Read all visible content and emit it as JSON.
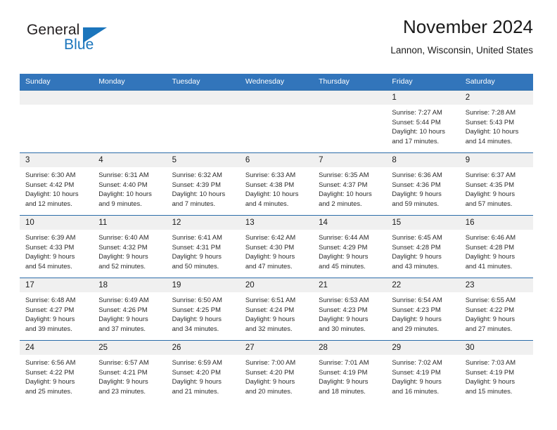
{
  "brand": {
    "name_part1": "General",
    "name_part2": "Blue",
    "accent_color": "#1b75bc",
    "logo_icon": "triangle-icon"
  },
  "header": {
    "title": "November 2024",
    "subtitle": "Lannon, Wisconsin, United States"
  },
  "calendar": {
    "header_bg": "#3275bb",
    "daynum_bg": "#f0f0f0",
    "border_color": "#2b6ca8",
    "weekdays": [
      "Sunday",
      "Monday",
      "Tuesday",
      "Wednesday",
      "Thursday",
      "Friday",
      "Saturday"
    ],
    "weeks": [
      [
        {
          "day": "",
          "sunrise": "",
          "sunset": "",
          "daylight": ""
        },
        {
          "day": "",
          "sunrise": "",
          "sunset": "",
          "daylight": ""
        },
        {
          "day": "",
          "sunrise": "",
          "sunset": "",
          "daylight": ""
        },
        {
          "day": "",
          "sunrise": "",
          "sunset": "",
          "daylight": ""
        },
        {
          "day": "",
          "sunrise": "",
          "sunset": "",
          "daylight": ""
        },
        {
          "day": "1",
          "sunrise": "Sunrise: 7:27 AM",
          "sunset": "Sunset: 5:44 PM",
          "daylight": "Daylight: 10 hours and 17 minutes."
        },
        {
          "day": "2",
          "sunrise": "Sunrise: 7:28 AM",
          "sunset": "Sunset: 5:43 PM",
          "daylight": "Daylight: 10 hours and 14 minutes."
        }
      ],
      [
        {
          "day": "3",
          "sunrise": "Sunrise: 6:30 AM",
          "sunset": "Sunset: 4:42 PM",
          "daylight": "Daylight: 10 hours and 12 minutes."
        },
        {
          "day": "4",
          "sunrise": "Sunrise: 6:31 AM",
          "sunset": "Sunset: 4:40 PM",
          "daylight": "Daylight: 10 hours and 9 minutes."
        },
        {
          "day": "5",
          "sunrise": "Sunrise: 6:32 AM",
          "sunset": "Sunset: 4:39 PM",
          "daylight": "Daylight: 10 hours and 7 minutes."
        },
        {
          "day": "6",
          "sunrise": "Sunrise: 6:33 AM",
          "sunset": "Sunset: 4:38 PM",
          "daylight": "Daylight: 10 hours and 4 minutes."
        },
        {
          "day": "7",
          "sunrise": "Sunrise: 6:35 AM",
          "sunset": "Sunset: 4:37 PM",
          "daylight": "Daylight: 10 hours and 2 minutes."
        },
        {
          "day": "8",
          "sunrise": "Sunrise: 6:36 AM",
          "sunset": "Sunset: 4:36 PM",
          "daylight": "Daylight: 9 hours and 59 minutes."
        },
        {
          "day": "9",
          "sunrise": "Sunrise: 6:37 AM",
          "sunset": "Sunset: 4:35 PM",
          "daylight": "Daylight: 9 hours and 57 minutes."
        }
      ],
      [
        {
          "day": "10",
          "sunrise": "Sunrise: 6:39 AM",
          "sunset": "Sunset: 4:33 PM",
          "daylight": "Daylight: 9 hours and 54 minutes."
        },
        {
          "day": "11",
          "sunrise": "Sunrise: 6:40 AM",
          "sunset": "Sunset: 4:32 PM",
          "daylight": "Daylight: 9 hours and 52 minutes."
        },
        {
          "day": "12",
          "sunrise": "Sunrise: 6:41 AM",
          "sunset": "Sunset: 4:31 PM",
          "daylight": "Daylight: 9 hours and 50 minutes."
        },
        {
          "day": "13",
          "sunrise": "Sunrise: 6:42 AM",
          "sunset": "Sunset: 4:30 PM",
          "daylight": "Daylight: 9 hours and 47 minutes."
        },
        {
          "day": "14",
          "sunrise": "Sunrise: 6:44 AM",
          "sunset": "Sunset: 4:29 PM",
          "daylight": "Daylight: 9 hours and 45 minutes."
        },
        {
          "day": "15",
          "sunrise": "Sunrise: 6:45 AM",
          "sunset": "Sunset: 4:28 PM",
          "daylight": "Daylight: 9 hours and 43 minutes."
        },
        {
          "day": "16",
          "sunrise": "Sunrise: 6:46 AM",
          "sunset": "Sunset: 4:28 PM",
          "daylight": "Daylight: 9 hours and 41 minutes."
        }
      ],
      [
        {
          "day": "17",
          "sunrise": "Sunrise: 6:48 AM",
          "sunset": "Sunset: 4:27 PM",
          "daylight": "Daylight: 9 hours and 39 minutes."
        },
        {
          "day": "18",
          "sunrise": "Sunrise: 6:49 AM",
          "sunset": "Sunset: 4:26 PM",
          "daylight": "Daylight: 9 hours and 37 minutes."
        },
        {
          "day": "19",
          "sunrise": "Sunrise: 6:50 AM",
          "sunset": "Sunset: 4:25 PM",
          "daylight": "Daylight: 9 hours and 34 minutes."
        },
        {
          "day": "20",
          "sunrise": "Sunrise: 6:51 AM",
          "sunset": "Sunset: 4:24 PM",
          "daylight": "Daylight: 9 hours and 32 minutes."
        },
        {
          "day": "21",
          "sunrise": "Sunrise: 6:53 AM",
          "sunset": "Sunset: 4:23 PM",
          "daylight": "Daylight: 9 hours and 30 minutes."
        },
        {
          "day": "22",
          "sunrise": "Sunrise: 6:54 AM",
          "sunset": "Sunset: 4:23 PM",
          "daylight": "Daylight: 9 hours and 29 minutes."
        },
        {
          "day": "23",
          "sunrise": "Sunrise: 6:55 AM",
          "sunset": "Sunset: 4:22 PM",
          "daylight": "Daylight: 9 hours and 27 minutes."
        }
      ],
      [
        {
          "day": "24",
          "sunrise": "Sunrise: 6:56 AM",
          "sunset": "Sunset: 4:22 PM",
          "daylight": "Daylight: 9 hours and 25 minutes."
        },
        {
          "day": "25",
          "sunrise": "Sunrise: 6:57 AM",
          "sunset": "Sunset: 4:21 PM",
          "daylight": "Daylight: 9 hours and 23 minutes."
        },
        {
          "day": "26",
          "sunrise": "Sunrise: 6:59 AM",
          "sunset": "Sunset: 4:20 PM",
          "daylight": "Daylight: 9 hours and 21 minutes."
        },
        {
          "day": "27",
          "sunrise": "Sunrise: 7:00 AM",
          "sunset": "Sunset: 4:20 PM",
          "daylight": "Daylight: 9 hours and 20 minutes."
        },
        {
          "day": "28",
          "sunrise": "Sunrise: 7:01 AM",
          "sunset": "Sunset: 4:19 PM",
          "daylight": "Daylight: 9 hours and 18 minutes."
        },
        {
          "day": "29",
          "sunrise": "Sunrise: 7:02 AM",
          "sunset": "Sunset: 4:19 PM",
          "daylight": "Daylight: 9 hours and 16 minutes."
        },
        {
          "day": "30",
          "sunrise": "Sunrise: 7:03 AM",
          "sunset": "Sunset: 4:19 PM",
          "daylight": "Daylight: 9 hours and 15 minutes."
        }
      ]
    ]
  }
}
